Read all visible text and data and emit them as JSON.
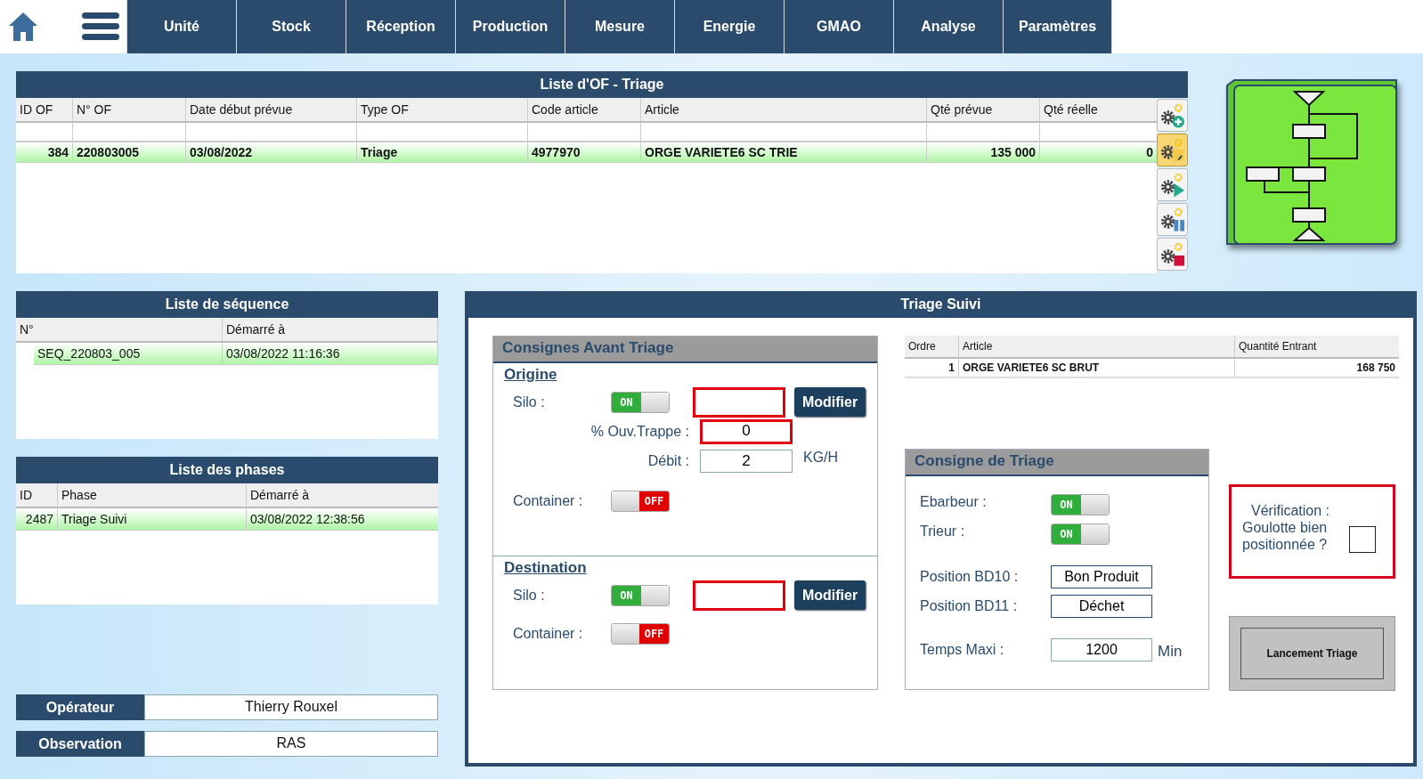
{
  "nav": {
    "items": [
      "Unité",
      "Stock",
      "Réception",
      "Production",
      "Mesure",
      "Energie",
      "GMAO",
      "Analyse",
      "Paramètres"
    ]
  },
  "of_list": {
    "title": "Liste d'OF - Triage",
    "columns": [
      "ID OF",
      "N° OF",
      "Date début prévue",
      "Type OF",
      "Code article",
      "Article",
      "Qté prévue",
      "Qté réelle"
    ],
    "rows": [
      {
        "cells": [
          "384",
          "220803005",
          "03/08/2022",
          "Triage",
          "4977970",
          "ORGE VARIETE6 SC TRIE",
          "135 000",
          "0"
        ],
        "selected": true
      }
    ]
  },
  "of_actions": [
    {
      "kind": "add",
      "selected": false
    },
    {
      "kind": "edit",
      "selected": true
    },
    {
      "kind": "start",
      "selected": false
    },
    {
      "kind": "pause",
      "selected": false
    },
    {
      "kind": "stop",
      "selected": false
    }
  ],
  "sequences": {
    "title": "Liste de séquence",
    "columns": [
      "N°",
      "Démarré à"
    ],
    "rows": [
      {
        "cells": [
          "SEQ_220803_005",
          "03/08/2022 11:16:36"
        ],
        "selected": true
      }
    ]
  },
  "phases": {
    "title": "Liste des phases",
    "columns": [
      "ID",
      "Phase",
      "Démarré à"
    ],
    "rows": [
      {
        "cells": [
          "2487",
          "Triage Suivi",
          "03/08/2022 12:38:56"
        ],
        "selected": true
      }
    ]
  },
  "operator": {
    "label": "Opérateur",
    "value": "Thierry Rouxel"
  },
  "observation": {
    "label": "Observation",
    "value": "RAS"
  },
  "triage_suivi": {
    "title": "Triage Suivi",
    "consignes_avant": {
      "title": "Consignes Avant Triage",
      "sections": [
        {
          "title": "Origine",
          "rows": [
            {
              "kind": "silo",
              "label": "Silo :",
              "on": true,
              "switch_text": "ON",
              "alert": true,
              "button": "Modifier"
            },
            {
              "kind": "field",
              "label": "% Ouv.Trappe :",
              "value": "0",
              "alert": true
            },
            {
              "kind": "field",
              "label": "Débit :",
              "value": "2",
              "alert": false,
              "unit": "KG/H"
            },
            {
              "kind": "switch",
              "label": "Container :",
              "on": false,
              "switch_text": "OFF"
            }
          ]
        },
        {
          "title": "Destination",
          "rows": [
            {
              "kind": "silo",
              "label": "Silo :",
              "on": true,
              "switch_text": "ON",
              "alert": true,
              "button": "Modifier"
            },
            {
              "kind": "switch",
              "label": "Container :",
              "on": false,
              "switch_text": "OFF"
            }
          ]
        }
      ]
    },
    "entries": {
      "columns": [
        "Ordre",
        "Article",
        "Quantité Entrant"
      ],
      "rows": [
        {
          "cells": [
            "1",
            "ORGE VARIETE6 SC BRUT",
            "168 750"
          ]
        }
      ]
    },
    "consigne_triage": {
      "title": "Consigne de Triage",
      "rows": [
        {
          "kind": "switch",
          "label": "Ebarbeur :",
          "on": true,
          "switch_text": "ON"
        },
        {
          "kind": "switch",
          "label": "Trieur :",
          "on": true,
          "switch_text": "ON"
        },
        {
          "kind": "value",
          "label": "Position BD10 :",
          "value": "Bon Produit"
        },
        {
          "kind": "value",
          "label": "Position BD11 :",
          "value": "Déchet"
        },
        {
          "kind": "field",
          "label": "Temps Maxi :",
          "value": "1200",
          "unit": "Min"
        }
      ]
    },
    "verification": {
      "title": "Vérification :",
      "question": "Goulotte bien positionnée ?",
      "checked": false
    },
    "launch_button": "Lancement Triage"
  }
}
